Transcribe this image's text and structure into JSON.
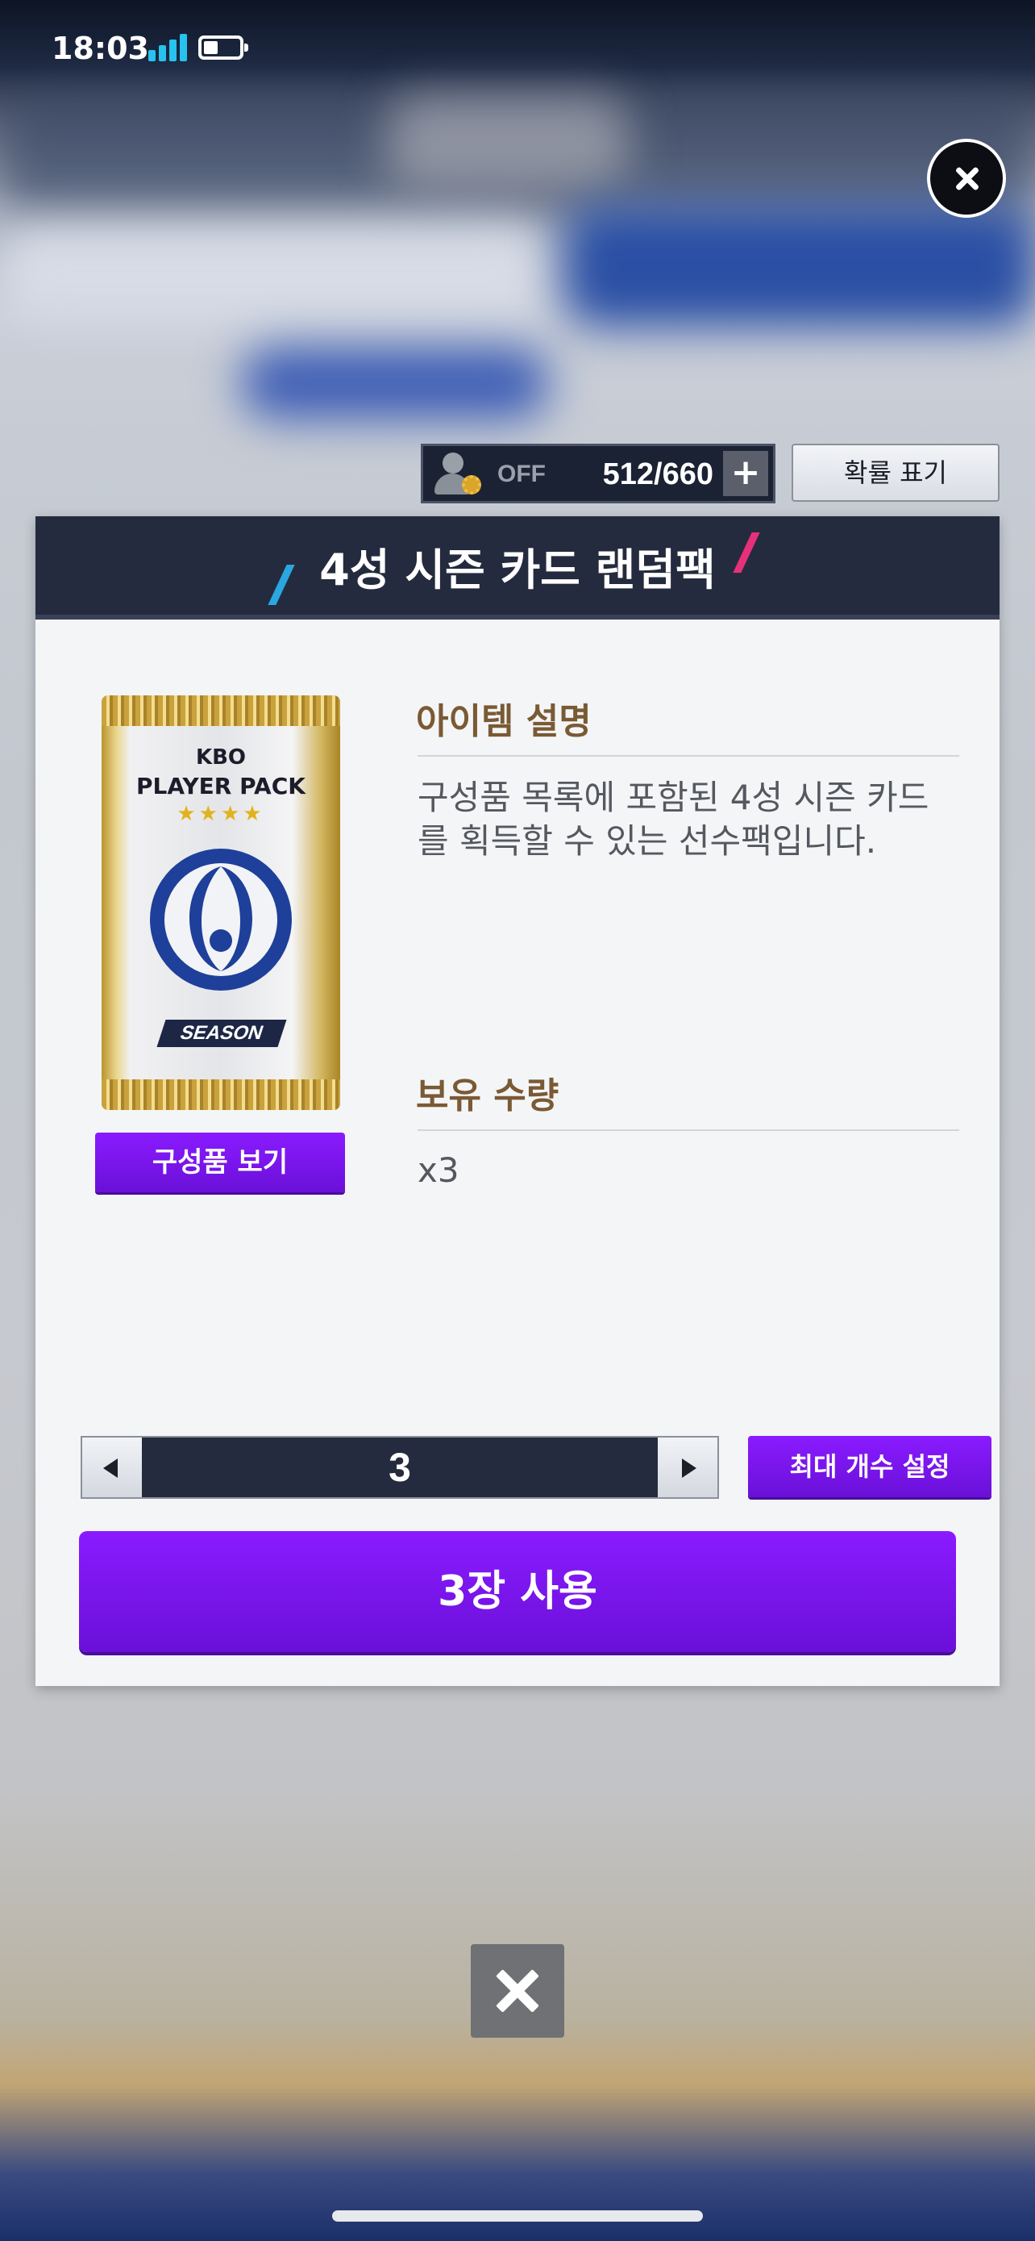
{
  "status_bar": {
    "time": "18:03"
  },
  "header": {
    "stamina_state": "OFF",
    "stamina_count": "512/660",
    "plus_label": "+",
    "probability_label": "확률 표기"
  },
  "panel": {
    "title": "4성 시즌 카드 랜덤팩",
    "pack": {
      "line1": "KBO",
      "line2": "PLAYER PACK",
      "stars": "★★★★",
      "badge": "SEASON"
    },
    "components_button": "구성품 보기",
    "description_label": "아이템 설명",
    "description_text": "구성품 목록에 포함된 4성 시즌 카드를 획득할 수 있는 선수팩입니다.",
    "owned_label": "보유 수량",
    "owned_value": "x3",
    "quantity": "3",
    "max_button": "최대 개수 설정",
    "use_button": "3장 사용"
  },
  "colors": {
    "accent_purple": "#7a16f0",
    "header_navy": "#252b3e",
    "label_brown": "#7a5a34"
  }
}
